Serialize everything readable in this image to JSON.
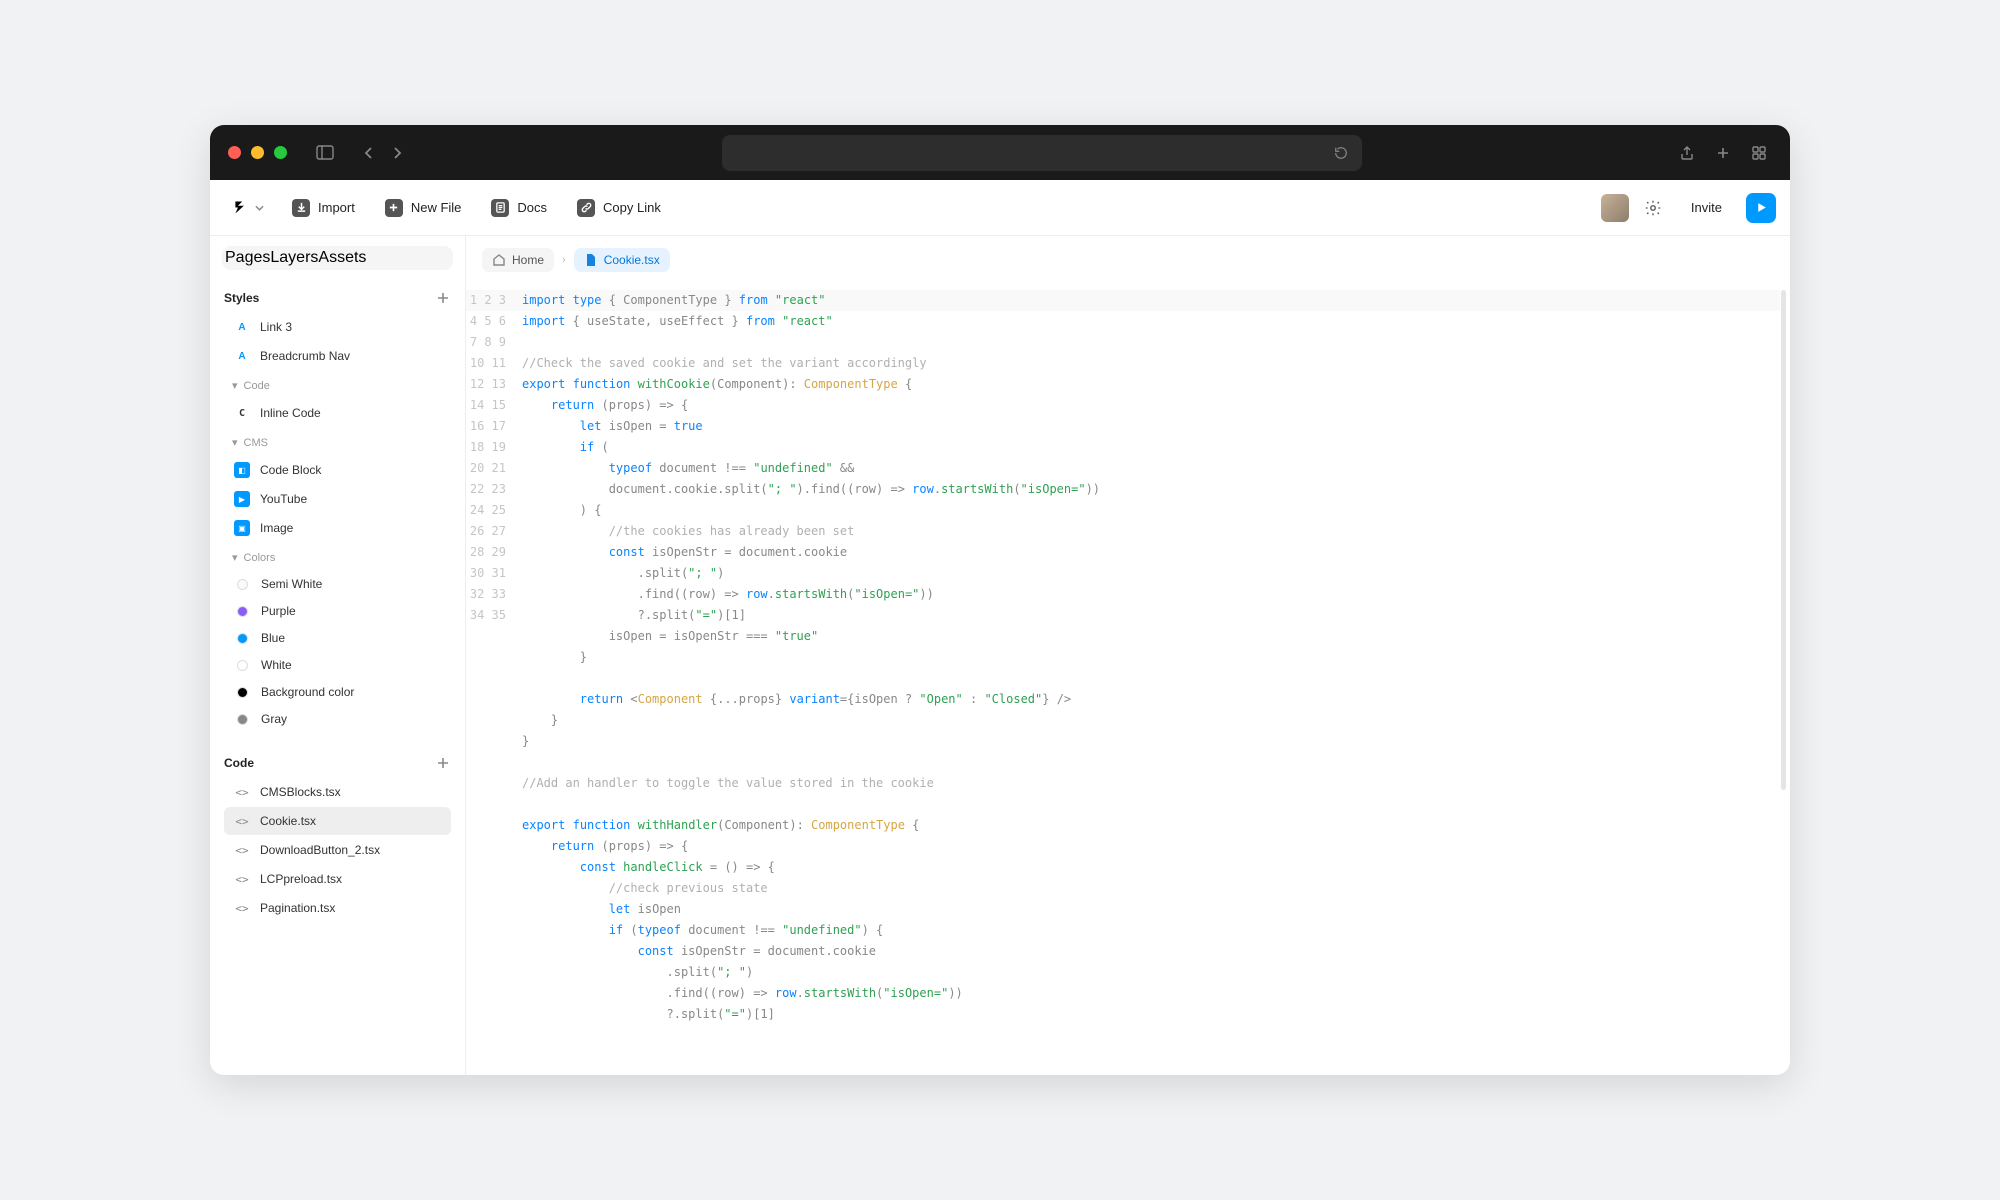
{
  "toolbar": {
    "import": "Import",
    "newfile": "New File",
    "docs": "Docs",
    "copylink": "Copy Link",
    "invite": "Invite"
  },
  "tabs": {
    "pages": "Pages",
    "layers": "Layers",
    "assets": "Assets"
  },
  "styles": {
    "label": "Styles",
    "link3": "Link 3",
    "breadcrumb": "Breadcrumb Nav",
    "code_group": "Code",
    "inline_code": "Inline Code",
    "cms_group": "CMS",
    "code_block": "Code Block",
    "youtube": "YouTube",
    "image": "Image",
    "colors_group": "Colors",
    "semiwhite": "Semi White",
    "purple": "Purple",
    "blue": "Blue",
    "white": "White",
    "bgcolor": "Background color",
    "gray": "Gray"
  },
  "swatches": {
    "semiwhite": "#fafafa",
    "purple": "#8b5cf6",
    "blue": "#0099ff",
    "white": "#ffffff",
    "bgcolor": "#000000",
    "gray": "#888888"
  },
  "code_section": {
    "label": "Code",
    "files": [
      "CMSBlocks.tsx",
      "Cookie.tsx",
      "DownloadButton_2.tsx",
      "LCPpreload.tsx",
      "Pagination.tsx"
    ]
  },
  "breadcrumb": {
    "home": "Home",
    "file": "Cookie.tsx"
  },
  "editor": {
    "highlight_line": 1,
    "lines": [
      [
        [
          "kw",
          "import"
        ],
        [
          "",
          " "
        ],
        [
          "kw",
          "type"
        ],
        [
          "",
          " { ComponentType } "
        ],
        [
          "kw",
          "from"
        ],
        [
          "",
          " "
        ],
        [
          "st",
          "\"react\""
        ]
      ],
      [
        [
          "kw",
          "import"
        ],
        [
          "",
          " { useState, useEffect } "
        ],
        [
          "kw",
          "from"
        ],
        [
          "",
          " "
        ],
        [
          "st",
          "\"react\""
        ]
      ],
      [],
      [
        [
          "cm",
          "//Check the saved cookie and set the variant accordingly"
        ]
      ],
      [
        [
          "kw",
          "export"
        ],
        [
          "",
          " "
        ],
        [
          "kw",
          "function"
        ],
        [
          "",
          " "
        ],
        [
          "fn",
          "withCookie"
        ],
        [
          "",
          "(Component): "
        ],
        [
          "ty",
          "ComponentType"
        ],
        [
          "",
          " {"
        ]
      ],
      [
        [
          "",
          "    "
        ],
        [
          "kw",
          "return"
        ],
        [
          "",
          " (props) => {"
        ]
      ],
      [
        [
          "",
          "        "
        ],
        [
          "kw",
          "let"
        ],
        [
          "",
          " isOpen = "
        ],
        [
          "bo",
          "true"
        ]
      ],
      [
        [
          "",
          "        "
        ],
        [
          "kw",
          "if"
        ],
        [
          "",
          " ("
        ]
      ],
      [
        [
          "",
          "            "
        ],
        [
          "kw",
          "typeof"
        ],
        [
          "",
          " document !== "
        ],
        [
          "st",
          "\"undefined\""
        ],
        [
          "",
          " &&"
        ]
      ],
      [
        [
          "",
          "            document.cookie.split("
        ],
        [
          "st",
          "\"; \""
        ],
        [
          "",
          ").find((row) => "
        ],
        [
          "va",
          "row"
        ],
        [
          "",
          "."
        ],
        [
          "fn",
          "startsWith"
        ],
        [
          "",
          "("
        ],
        [
          "st",
          "\"isOpen=\""
        ],
        [
          "",
          "))"
        ]
      ],
      [
        [
          "",
          "        ) {"
        ]
      ],
      [
        [
          "",
          "            "
        ],
        [
          "cm",
          "//the cookies has already been set"
        ]
      ],
      [
        [
          "",
          "            "
        ],
        [
          "kw",
          "const"
        ],
        [
          "",
          " isOpenStr = document.cookie"
        ]
      ],
      [
        [
          "",
          "                .split("
        ],
        [
          "st",
          "\"; \""
        ],
        [
          "",
          ")"
        ]
      ],
      [
        [
          "",
          "                .find((row) => "
        ],
        [
          "va",
          "row"
        ],
        [
          "",
          "."
        ],
        [
          "fn",
          "startsWith"
        ],
        [
          "",
          "("
        ],
        [
          "st",
          "\"isOpen=\""
        ],
        [
          "",
          "))"
        ]
      ],
      [
        [
          "",
          "                ?.split("
        ],
        [
          "st",
          "\"=\""
        ],
        [
          "",
          ")[1]"
        ]
      ],
      [
        [
          "",
          "            isOpen = isOpenStr === "
        ],
        [
          "st",
          "\"true\""
        ]
      ],
      [
        [
          "",
          "        }"
        ]
      ],
      [],
      [
        [
          "",
          "        "
        ],
        [
          "kw",
          "return"
        ],
        [
          "",
          " <"
        ],
        [
          "ty",
          "Component"
        ],
        [
          "",
          " {...props} "
        ],
        [
          "va",
          "variant"
        ],
        [
          "",
          "={isOpen ? "
        ],
        [
          "st",
          "\"Open\""
        ],
        [
          "",
          " : "
        ],
        [
          "st",
          "\"Closed\""
        ],
        [
          "",
          "} />"
        ]
      ],
      [
        [
          "",
          "    }"
        ]
      ],
      [
        [
          "",
          "}"
        ]
      ],
      [],
      [
        [
          "cm",
          "//Add an handler to toggle the value stored in the cookie"
        ]
      ],
      [],
      [
        [
          "kw",
          "export"
        ],
        [
          "",
          " "
        ],
        [
          "kw",
          "function"
        ],
        [
          "",
          " "
        ],
        [
          "fn",
          "withHandler"
        ],
        [
          "",
          "(Component): "
        ],
        [
          "ty",
          "ComponentType"
        ],
        [
          "",
          " {"
        ]
      ],
      [
        [
          "",
          "    "
        ],
        [
          "kw",
          "return"
        ],
        [
          "",
          " (props) => {"
        ]
      ],
      [
        [
          "",
          "        "
        ],
        [
          "kw",
          "const"
        ],
        [
          "",
          " "
        ],
        [
          "fn",
          "handleClick"
        ],
        [
          "",
          " = () => {"
        ]
      ],
      [
        [
          "",
          "            "
        ],
        [
          "cm",
          "//check previous state"
        ]
      ],
      [
        [
          "",
          "            "
        ],
        [
          "kw",
          "let"
        ],
        [
          "",
          " isOpen"
        ]
      ],
      [
        [
          "",
          "            "
        ],
        [
          "kw",
          "if"
        ],
        [
          "",
          " ("
        ],
        [
          "kw",
          "typeof"
        ],
        [
          "",
          " document !== "
        ],
        [
          "st",
          "\"undefined\""
        ],
        [
          "",
          ") {"
        ]
      ],
      [
        [
          "",
          "                "
        ],
        [
          "kw",
          "const"
        ],
        [
          "",
          " isOpenStr = document.cookie"
        ]
      ],
      [
        [
          "",
          "                    .split("
        ],
        [
          "st",
          "\"; \""
        ],
        [
          "",
          ")"
        ]
      ],
      [
        [
          "",
          "                    .find((row) => "
        ],
        [
          "va",
          "row"
        ],
        [
          "",
          "."
        ],
        [
          "fn",
          "startsWith"
        ],
        [
          "",
          "("
        ],
        [
          "st",
          "\"isOpen=\""
        ],
        [
          "",
          "))"
        ]
      ],
      [
        [
          "",
          "                    ?.split("
        ],
        [
          "st",
          "\"=\""
        ],
        [
          "",
          ")[1]"
        ]
      ]
    ]
  }
}
